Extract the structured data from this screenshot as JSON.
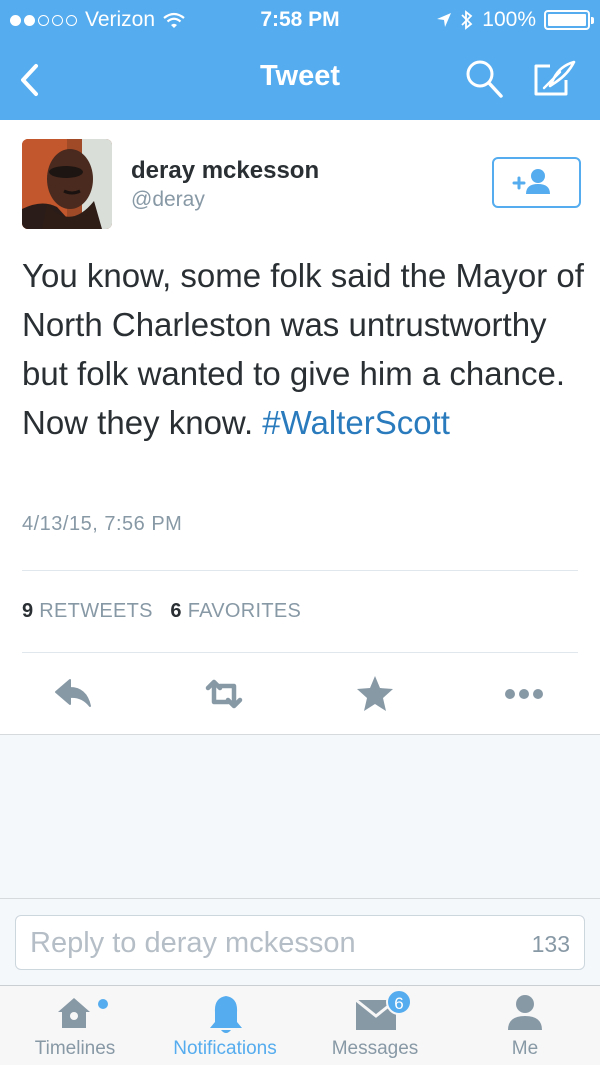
{
  "status_bar": {
    "carrier": "Verizon",
    "time": "7:58 PM",
    "battery": "100%",
    "signal_bars_filled": 2,
    "signal_bars_total": 5
  },
  "nav": {
    "title": "Tweet",
    "icons": [
      "back-chevron-icon",
      "search-icon",
      "compose-icon"
    ]
  },
  "tweet": {
    "author_name": "deray mckesson",
    "author_handle": "@deray",
    "text": "You know, some folk said the Mayor of North Charleston was untrustworthy but folk wanted to give him a chance. Now they know. ",
    "hashtag": "#WalterScott",
    "timestamp": "4/13/15, 7:56 PM",
    "retweet_count": "9",
    "retweet_label": "RETWEETS",
    "favorite_count": "6",
    "favorite_label": "FAVORITES",
    "actions": [
      "reply-icon",
      "retweet-icon",
      "favorite-star-icon",
      "more-icon"
    ]
  },
  "reply": {
    "placeholder": "Reply to deray mckesson",
    "char_count": "133"
  },
  "tabbar": {
    "tabs": [
      {
        "label": "Timelines",
        "icon": "home-icon",
        "active": false
      },
      {
        "label": "Notifications",
        "icon": "bell-icon",
        "active": true
      },
      {
        "label": "Messages",
        "icon": "envelope-icon",
        "active": false,
        "badge": "6"
      },
      {
        "label": "Me",
        "icon": "person-icon",
        "active": false
      }
    ]
  },
  "colors": {
    "brand": "#55acee",
    "text": "#292f33",
    "muted": "#8899a6",
    "link": "#2a7bbd"
  }
}
